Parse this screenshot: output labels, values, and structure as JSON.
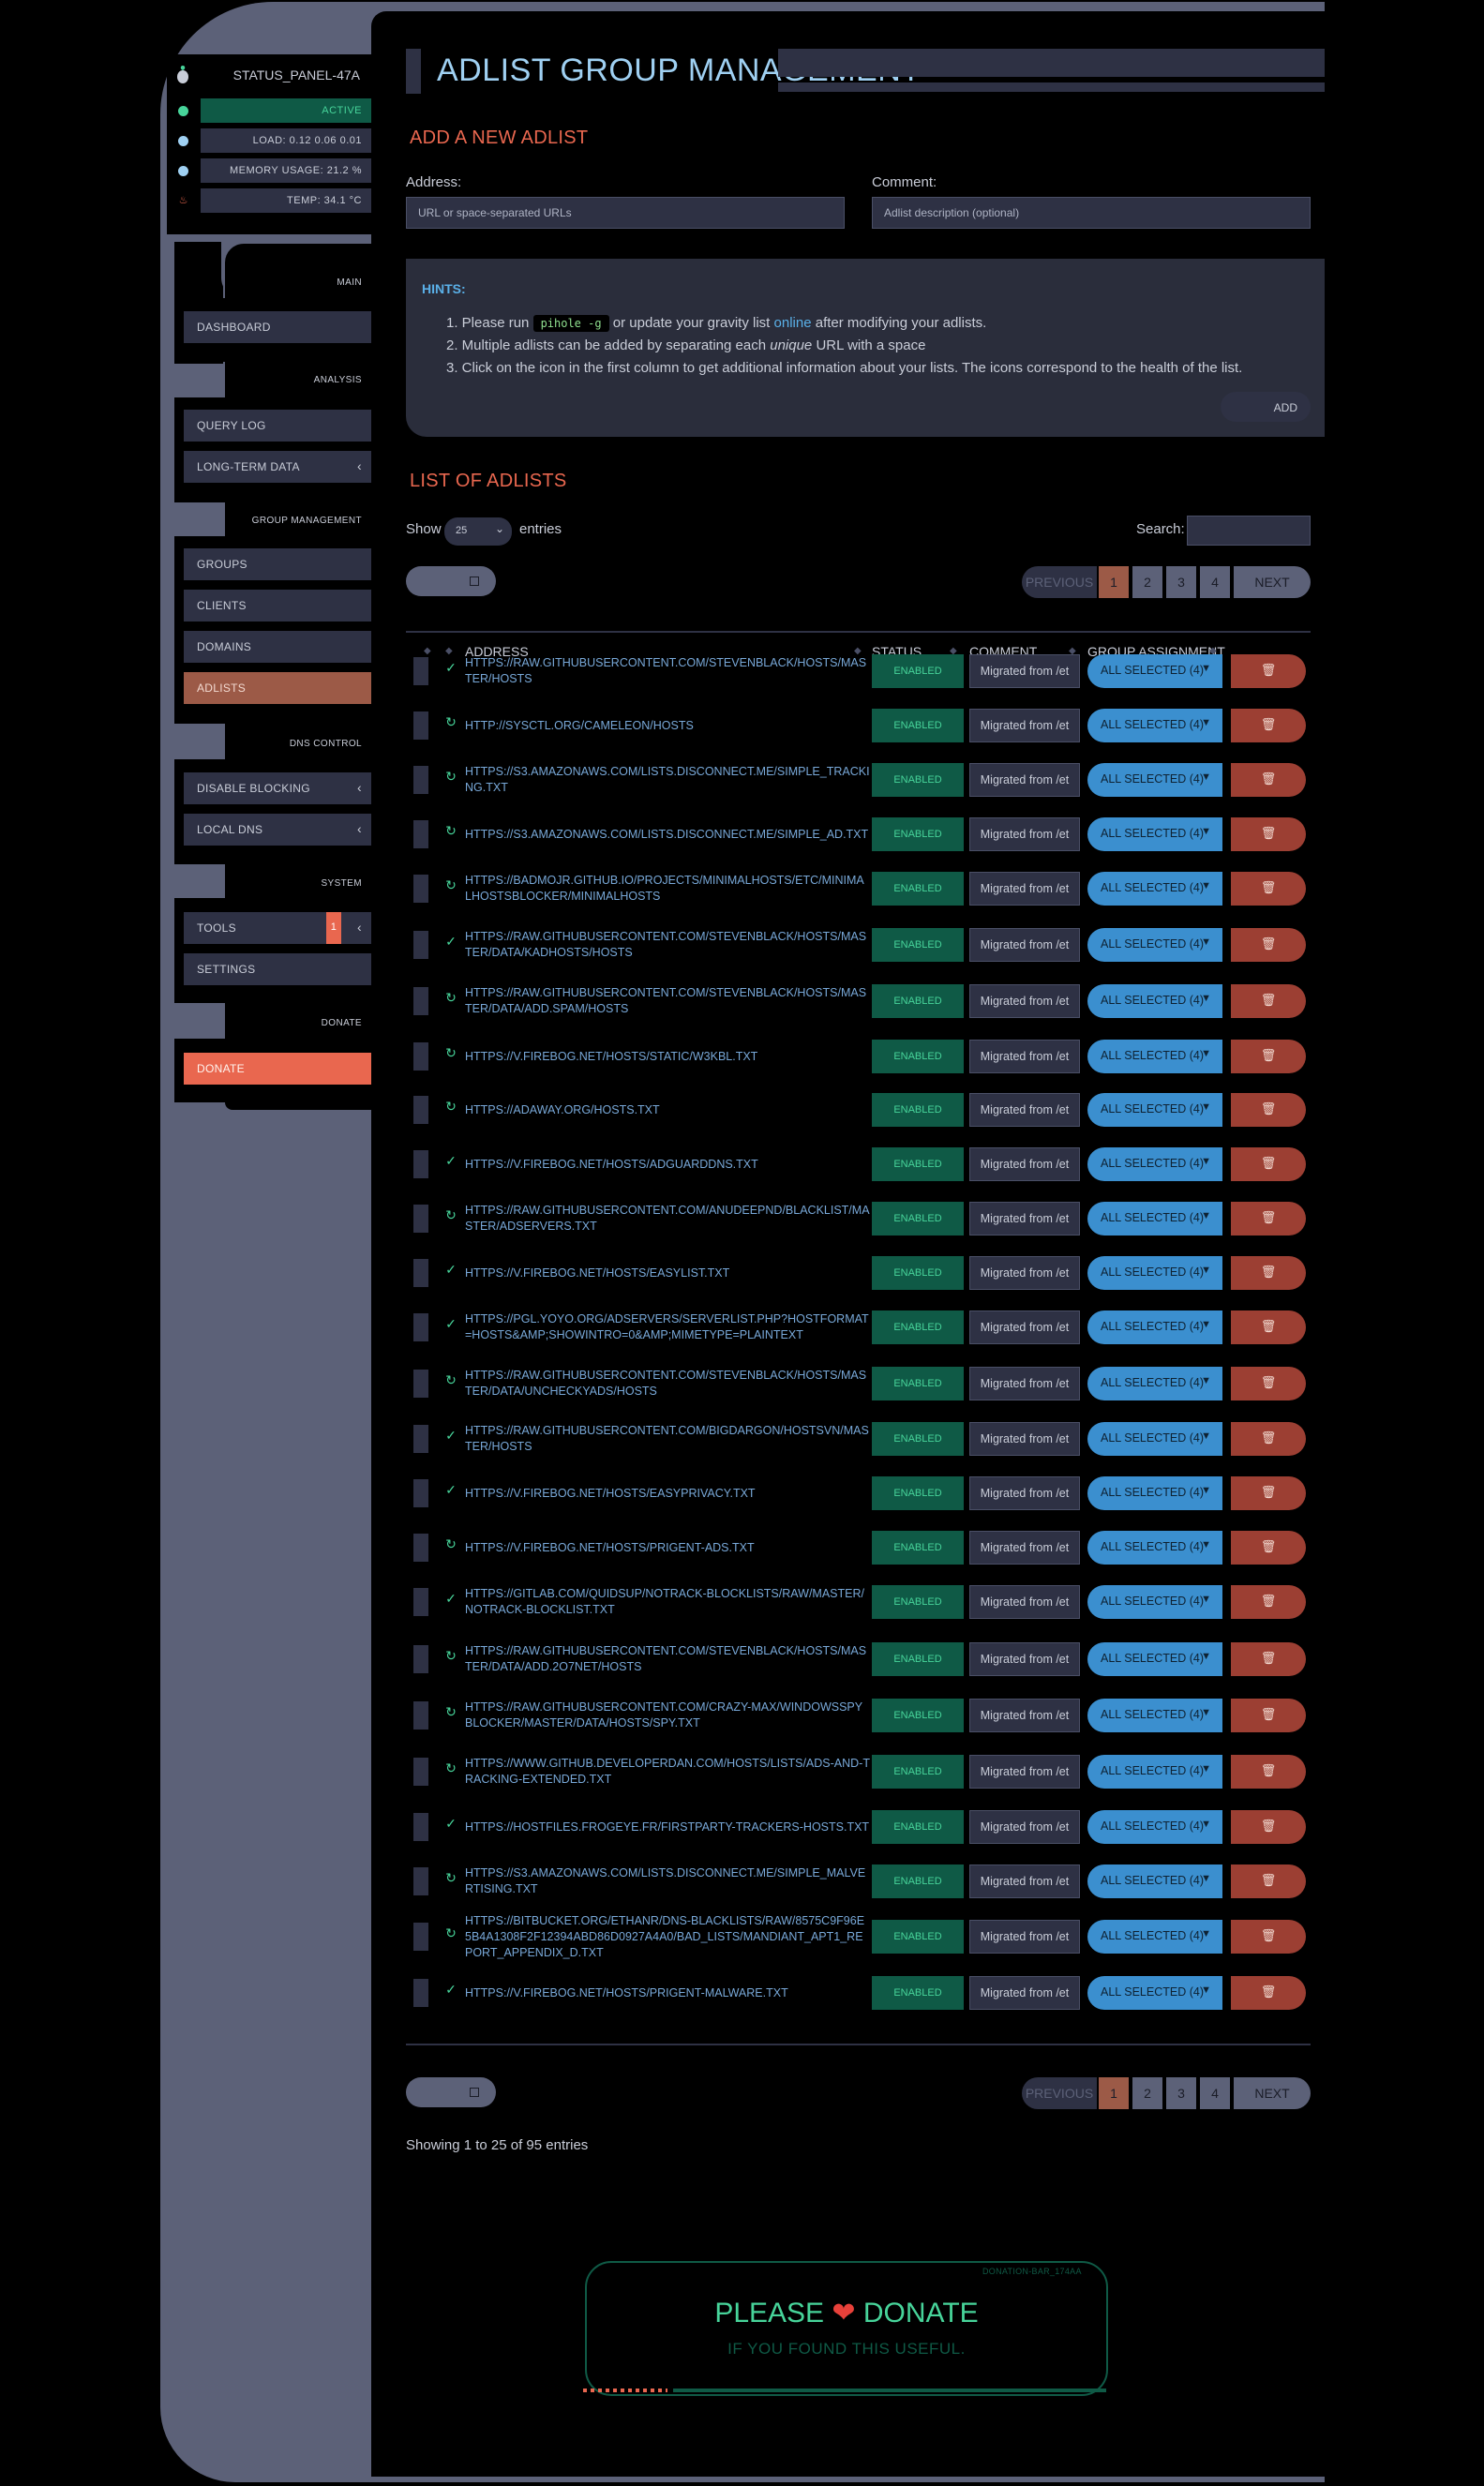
{
  "status_panel": {
    "title": "STATUS_PANEL-47A",
    "state": "ACTIVE",
    "load": "LOAD:  0.12  0.06  0.01",
    "memory": "MEMORY USAGE:  21.2 %",
    "temp": "TEMP: 34.1 °C",
    "colors": {
      "active": "#47d49a",
      "dot": "#5ab0e8",
      "temp_icon": "#e9674f"
    }
  },
  "sidebar": {
    "sections": {
      "main": "MAIN",
      "analysis": "ANALYSIS",
      "group_management": "GROUP MANAGEMENT",
      "dns_control": "DNS CONTROL",
      "system": "SYSTEM",
      "donate": "DONATE"
    },
    "items": {
      "dashboard": "DASHBOARD",
      "query_log": "QUERY LOG",
      "long_term": "LONG-TERM DATA",
      "groups": "GROUPS",
      "clients": "CLIENTS",
      "domains": "DOMAINS",
      "adlists": "ADLISTS",
      "disable_blocking": "DISABLE BLOCKING",
      "local_dns": "LOCAL DNS",
      "tools": "TOOLS",
      "tools_badge": "1",
      "settings": "SETTINGS",
      "donate": "DONATE"
    }
  },
  "page": {
    "title": "ADLIST GROUP MANAGEMENT",
    "add_heading": "ADD A NEW ADLIST",
    "address_label": "Address:",
    "address_placeholder": "URL or space-separated URLs",
    "comment_label": "Comment:",
    "comment_placeholder": "Adlist description (optional)",
    "hints_title": "HINTS:",
    "hint1_pre": "1. Please run ",
    "hint1_code": "pihole -g",
    "hint1_mid": " or update your gravity list ",
    "hint1_link": "online",
    "hint1_post": " after modifying your adlists.",
    "hint2_pre": "2. Multiple adlists can be added by separating each ",
    "hint2_em": "unique",
    "hint2_post": " URL with a space",
    "hint3": "3. Click on the icon in the first column to get additional information about your lists. The icons correspond to the health of the list.",
    "add_button": "ADD",
    "list_heading": "LIST OF ADLISTS",
    "show_label": "Show",
    "show_value": "25",
    "entries_label": "entries",
    "search_label": "Search:",
    "pager": {
      "previous": "PREVIOUS",
      "pages": [
        "1",
        "2",
        "3",
        "4"
      ],
      "next": "NEXT"
    },
    "columns": {
      "address": "ADDRESS",
      "status": "STATUS",
      "comment": "COMMENT",
      "group": "GROUP ASSIGNMENT"
    },
    "info": "Showing 1 to 25 of 95 entries"
  },
  "rows": [
    {
      "addr": "https://raw.githubusercontent.com/StevenBlack/hosts/master/hosts",
      "health": "ok"
    },
    {
      "addr": "http://sysctl.org/cameleon/hosts",
      "health": "pend"
    },
    {
      "addr": "https://s3.amazonaws.com/lists.disconnect.me/simple_tracking.txt",
      "health": "pend"
    },
    {
      "addr": "https://s3.amazonaws.com/lists.disconnect.me/simple_ad.txt",
      "health": "pend"
    },
    {
      "addr": "https://badmojr.github.io/projects/minimalhosts/etc/minimalhostsblocker/minimalhosts",
      "health": "pend"
    },
    {
      "addr": "https://raw.githubusercontent.com/StevenBlack/hosts/master/data/KADhosts/hosts",
      "health": "ok"
    },
    {
      "addr": "https://raw.githubusercontent.com/StevenBlack/hosts/master/data/add.Spam/hosts",
      "health": "pend"
    },
    {
      "addr": "https://v.firebog.net/hosts/static/w3kbl.txt",
      "health": "pend"
    },
    {
      "addr": "https://adaway.org/hosts.txt",
      "health": "pend"
    },
    {
      "addr": "https://v.firebog.net/hosts/AdguardDNS.txt",
      "health": "ok"
    },
    {
      "addr": "https://raw.githubusercontent.com/anudeepND/blacklist/master/adservers.txt",
      "health": "pend"
    },
    {
      "addr": "https://v.firebog.net/hosts/Easylist.txt",
      "health": "ok"
    },
    {
      "addr": "https://pgl.yoyo.org/adservers/serverlist.php?hostformat=hosts&amp;showintro=0&amp;mimetype=plaintext",
      "health": "ok"
    },
    {
      "addr": "https://raw.githubusercontent.com/StevenBlack/hosts/master/data/UncheckyAds/hosts",
      "health": "pend"
    },
    {
      "addr": "https://raw.githubusercontent.com/bigdargon/hostsVN/master/hosts",
      "health": "ok"
    },
    {
      "addr": "https://v.firebog.net/hosts/Easyprivacy.txt",
      "health": "ok"
    },
    {
      "addr": "https://v.firebog.net/hosts/Prigent-Ads.txt",
      "health": "pend"
    },
    {
      "addr": "https://gitlab.com/quidsup/notrack-blocklists/raw/master/notrack-blocklist.txt",
      "health": "ok"
    },
    {
      "addr": "https://raw.githubusercontent.com/StevenBlack/hosts/master/data/add.2o7Net/hosts",
      "health": "pend"
    },
    {
      "addr": "https://raw.githubusercontent.com/crazy-max/WindowsSpyBlocker/master/data/hosts/spy.txt",
      "health": "pend"
    },
    {
      "addr": "https://www.github.developerdan.com/hosts/lists/ads-and-tracking-extended.txt",
      "health": "pend"
    },
    {
      "addr": "https://hostfiles.frogeye.fr/firstparty-trackers-hosts.txt",
      "health": "ok"
    },
    {
      "addr": "https://s3.amazonaws.com/lists.disconnect.me/simple_malvertising.txt",
      "health": "pend"
    },
    {
      "addr": "https://bitbucket.org/ethanr/dns-blacklists/raw/8575c9f96e5b4a1308f2f12394abd86d0927a4a0/bad_lists/Mandiant_APT1_Report_Appendix_D.txt",
      "health": "pend"
    },
    {
      "addr": "https://v.firebog.net/hosts/Prigent-Malware.txt",
      "health": "ok"
    }
  ],
  "row_defaults": {
    "status": "ENABLED",
    "comment": "Migrated from /et",
    "group": "ALL SELECTED (4)"
  },
  "icons": {
    "ok": "check-icon",
    "pend": "history-icon",
    "delete": "trash-icon",
    "caret": "caret-down-icon"
  },
  "donate_widget": {
    "code": "DONATION-BAR_174AA",
    "title_pre": "PLEASE",
    "heart": "❤",
    "title_post": "DONATE",
    "subtitle": "IF YOU FOUND THIS USEFUL."
  }
}
